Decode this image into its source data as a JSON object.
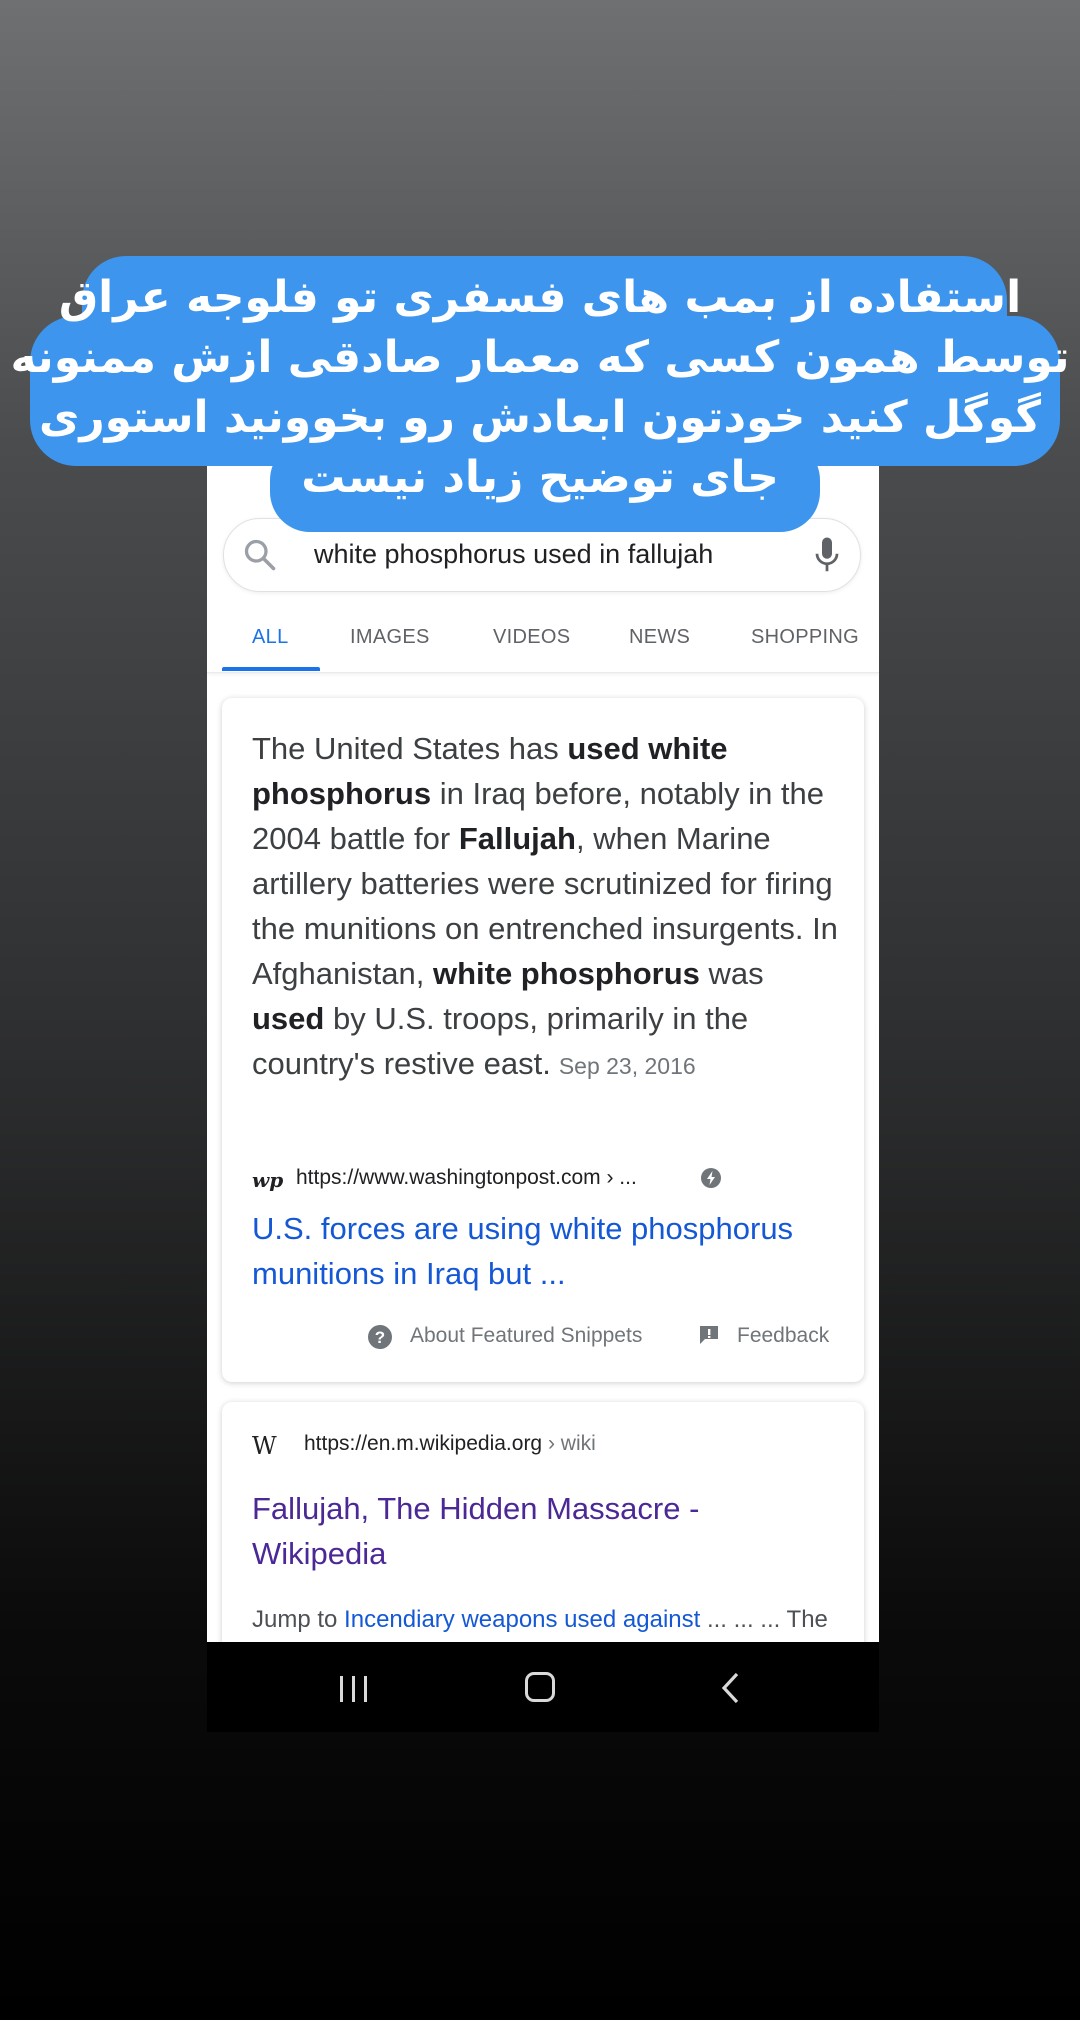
{
  "caption": {
    "lines": [
      "استفاده از بمب های فسفری تو فلوجه عراق",
      "توسط همون کسی که معمار صادقی ازش ممنونه",
      "گوگل کنید خودتون ابعادش رو بخوونید استوری",
      "جای توضیح زیاد نیست"
    ],
    "bubble_color": "#3d95ed"
  },
  "search": {
    "query": "white phosphorus used in fallujah",
    "search_icon": "search-icon",
    "mic_icon": "mic-icon"
  },
  "tabs": [
    {
      "label": "ALL",
      "active": true
    },
    {
      "label": "IMAGES"
    },
    {
      "label": "VIDEOS"
    },
    {
      "label": "NEWS"
    },
    {
      "label": "SHOPPING"
    }
  ],
  "featured_snippet": {
    "text_segments": [
      {
        "text": "The United States has ",
        "bold": false
      },
      {
        "text": "used white phosphorus",
        "bold": true
      },
      {
        "text": " in Iraq before, notably in the 2004 battle for ",
        "bold": false
      },
      {
        "text": "Fallujah",
        "bold": true
      },
      {
        "text": ", when Marine artillery batteries were scrutinized for firing the munitions on entrenched insurgents. In Afghanistan, ",
        "bold": false
      },
      {
        "text": "white phosphorus",
        "bold": true
      },
      {
        "text": " was ",
        "bold": false
      },
      {
        "text": "used",
        "bold": true
      },
      {
        "text": " by U.S. troops, primarily in the country's restive east.",
        "bold": false
      }
    ],
    "date": "Sep 23, 2016",
    "source_logo": "wp",
    "url": "https://www.washingtonpost.com › ...",
    "amp_icon": "amp-bolt-icon",
    "link_title": "U.S. forces are using white phosphorus munitions in Iraq but ...",
    "about_label": "About Featured Snippets",
    "feedback_label": "Feedback"
  },
  "wiki_result": {
    "logo": "W",
    "url": "https://en.m.wikipedia.org",
    "url_path": " › wiki",
    "title": "Fallujah, The Hidden Massacre - Wikipedia",
    "snippet_prefix": "Jump to ",
    "snippet_link": "Incendiary weapons used against",
    "snippet_more": " ... ... ... The use of white"
  },
  "colors": {
    "accent": "#1a73e8",
    "link": "#1558d6",
    "visited_link": "#4b2896"
  }
}
